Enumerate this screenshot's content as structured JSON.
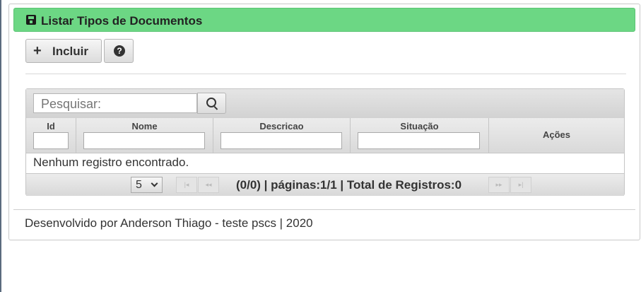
{
  "panel": {
    "title": "Listar Tipos de Documentos",
    "icon": "document-icon",
    "header_color": "#6cd784"
  },
  "toolbar": {
    "incluir_label": "Incluir",
    "help_label": "?"
  },
  "search": {
    "placeholder": "Pesquisar:"
  },
  "table": {
    "columns": [
      "Id",
      "Nome",
      "Descricao",
      "Situação",
      "Ações"
    ],
    "empty_message": "Nenhum registro encontrado."
  },
  "pager": {
    "rows_per_page": "5",
    "first_label": "|◂",
    "prev_label": "◂◂",
    "next_label": "▸▸",
    "last_label": "▸|",
    "info": "(0/0) | páginas:1/1 | Total de Registros:0"
  },
  "footer": {
    "text": "Desenvolvido por Anderson Thiago - teste pscs | 2020"
  }
}
